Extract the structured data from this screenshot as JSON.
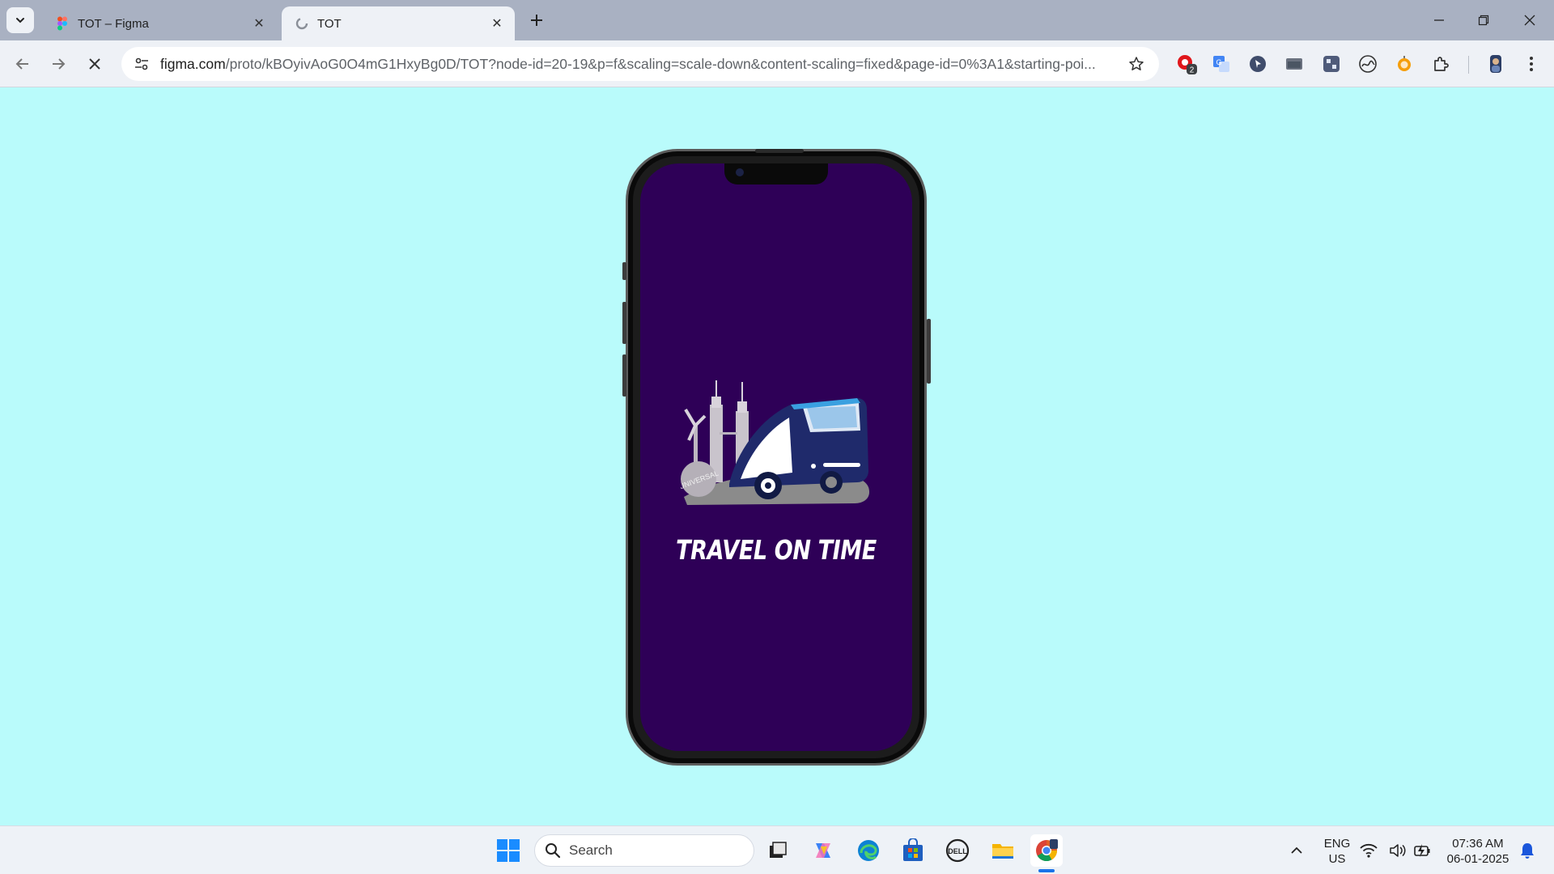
{
  "browser": {
    "tabs": [
      {
        "title": "TOT – Figma",
        "active": false
      },
      {
        "title": "TOT",
        "active": true
      }
    ],
    "url": {
      "host": "figma.com",
      "path": "/proto/kBOyivAoG0O4mG1HxyBg0D/TOT?node-id=20-19&p=f&scaling=scale-down&content-scaling=fixed&page-id=0%3A1&starting-poi..."
    },
    "extension_badge": "2"
  },
  "app": {
    "brand_text": "TRAVEL ON TIME",
    "logo_badge_text": "UNIVERSAL",
    "screen_color": "#2e0057",
    "page_background": "#b9fbfb"
  },
  "taskbar": {
    "search_placeholder": "Search",
    "language_line1": "ENG",
    "language_line2": "US",
    "time": "07:36 AM",
    "date": "06-01-2025"
  }
}
